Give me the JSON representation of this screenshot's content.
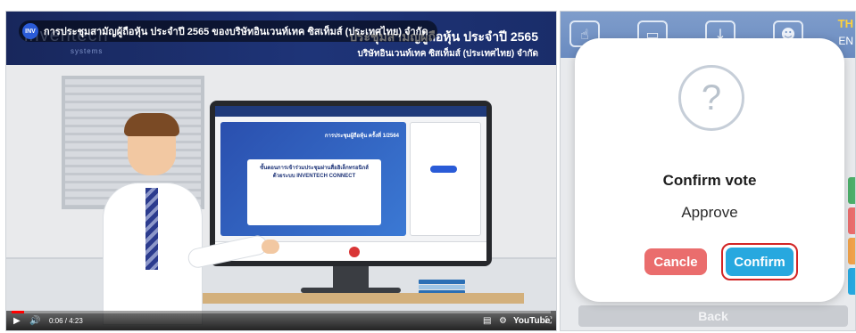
{
  "video": {
    "overlay_title": "การประชุมสามัญผู้ถือหุ้น ประจำปี 2565 ของบริษัทอินเวนท์เทค ซิสเท็มส์ (ประเทศไทย) จำกัด",
    "channel_badge": "INV",
    "banner": {
      "logo_text": "inventech",
      "logo_sub": "systems",
      "title": "ประชุมสามัญผู้ถือหุ้น ประจำปี 2565",
      "subtitle": "บริษัทอินเวนท์เทค ซิสเท็มส์ (ประเทศไทย) จำกัด"
    },
    "screen": {
      "main_title": "การประชุมผู้ถือหุ้น ครั้งที่ 1/2564",
      "card_line1": "ขั้นตอนการเข้าร่วมประชุมผ่านสื่ออิเล็กทรอนิกส์",
      "card_line2": "ด้วยระบบ INVENTECH CONNECT"
    },
    "player": {
      "time": "0:06 / 4:23",
      "progress": 0.023,
      "youtube_label": "YouTube"
    }
  },
  "panel": {
    "lang": {
      "active": "TH",
      "other": "EN"
    },
    "dialog": {
      "icon": "question-mark-icon",
      "title": "Confirm vote",
      "choice": "Approve",
      "cancel_label": "Cancle",
      "confirm_label": "Confirm"
    },
    "back_label": "Back",
    "colors": {
      "cancel": "#ea6d6d",
      "confirm": "#27a8df",
      "highlight": "#d22424",
      "topbar": "#7f9dcb"
    }
  }
}
